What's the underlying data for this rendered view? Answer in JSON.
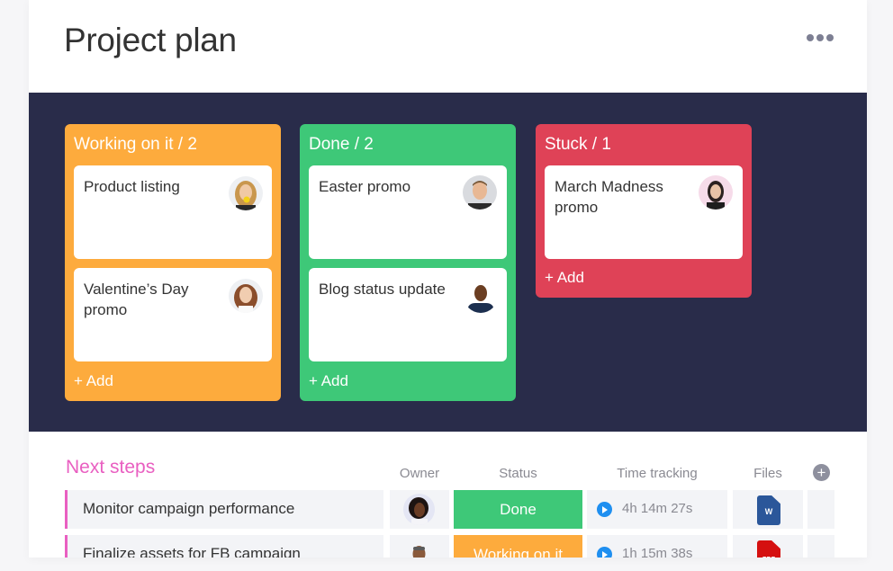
{
  "header": {
    "title": "Project plan",
    "more_icon": "more-horizontal-icon"
  },
  "board": {
    "columns": [
      {
        "title": "Working on it / 2",
        "color": "#fdab3d",
        "cards": [
          {
            "text": "Product listing",
            "avatar": "avatar-woman-blonde"
          },
          {
            "text": "Valentine’s Day promo",
            "avatar": "avatar-woman-redhead"
          }
        ],
        "add_label": "+ Add"
      },
      {
        "title": "Done / 2",
        "color": "#3ec878",
        "cards": [
          {
            "text": "Easter promo",
            "avatar": "avatar-man-beard"
          },
          {
            "text": "Blog status update",
            "avatar": "avatar-man-smiling"
          }
        ],
        "add_label": "+ Add"
      },
      {
        "title": "Stuck / 1",
        "color": "#df4257",
        "cards": [
          {
            "text": "March Madness promo",
            "avatar": "avatar-woman-dark-hair"
          }
        ],
        "add_label": "+ Add"
      }
    ]
  },
  "table": {
    "group_title": "Next steps",
    "group_color": "#e95fc1",
    "columns": [
      "Owner",
      "Status",
      "Time tracking",
      "Files"
    ],
    "add_column_icon": "plus-circle-icon",
    "rows": [
      {
        "name": "Monitor campaign performance",
        "owner": "avatar-woman-curly",
        "status": "Done",
        "status_color": "#3ec878",
        "time": "4h 14m 27s",
        "file_type": "W",
        "file_color": "#2b579a"
      },
      {
        "name": "Finalize assets for FB campaign",
        "owner": "avatar-man-bald",
        "status": "Working on it",
        "status_color": "#fdab3d",
        "time": "1h 15m 38s",
        "file_type": "PDF",
        "file_color": "#d51010"
      }
    ]
  }
}
